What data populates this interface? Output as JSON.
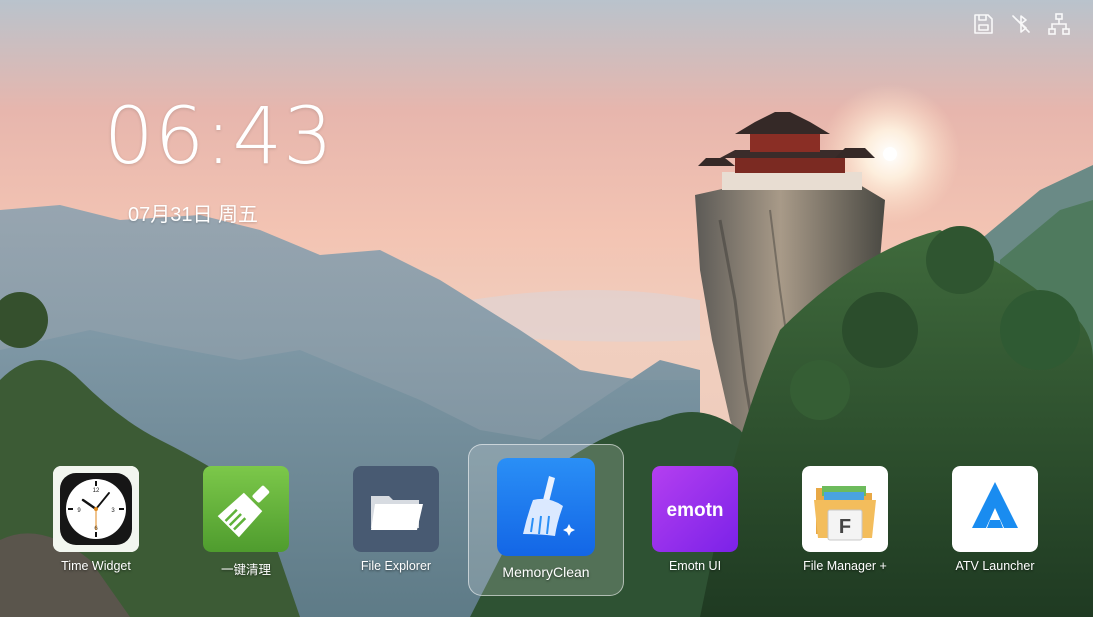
{
  "status_bar": {
    "icons": [
      "sd-card-icon",
      "bluetooth-off-icon",
      "ethernet-icon"
    ]
  },
  "clock": {
    "time": "06:43",
    "date": "07月31日 周五"
  },
  "apps": [
    {
      "label": "Time Widget",
      "icon": "clock-icon",
      "focused": false
    },
    {
      "label": "一键清理",
      "icon": "broom-clean-icon",
      "focused": false
    },
    {
      "label": "File Explorer",
      "icon": "folder-icon",
      "focused": false
    },
    {
      "label": "MemoryClean",
      "icon": "broom-icon",
      "focused": true
    },
    {
      "label": "Emotn UI",
      "icon": "emotn-logo-icon",
      "logo_text": "emotn",
      "focused": false
    },
    {
      "label": "File Manager +",
      "icon": "file-manager-icon",
      "logo_text": "F",
      "focused": false
    },
    {
      "label": "ATV Launcher",
      "icon": "atv-launcher-icon",
      "focused": false
    }
  ],
  "colors": {
    "emotn_purple": "#9b2ff0",
    "memoryclean_blue": "#1f7ff3",
    "clean_green": "#5fb23a",
    "folder_slate": "#485a72",
    "atv_blue": "#1a8cf0"
  }
}
